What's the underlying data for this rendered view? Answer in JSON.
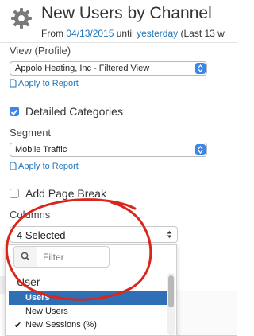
{
  "header": {
    "title": "New Users by Channel",
    "from_label": "From",
    "from_date": "04/13/2015",
    "until_label": "until",
    "until_date": "yesterday",
    "range_note": "(Last 13 w"
  },
  "view": {
    "label": "View (Profile)",
    "selected": "Appolo Heating, Inc - Filtered View",
    "apply_link": "Apply to Report"
  },
  "detailed": {
    "label": "Detailed Categories",
    "checked": true
  },
  "segment": {
    "label": "Segment",
    "selected": "Mobile Traffic",
    "apply_link": "Apply to Report"
  },
  "page_break": {
    "label": "Add Page Break",
    "checked": false
  },
  "columns": {
    "label": "Columns",
    "selected": "4 Selected",
    "filter_placeholder": "Filter",
    "group": "User",
    "options": [
      {
        "label": "Users",
        "highlighted": true,
        "checked": false
      },
      {
        "label": "New Users",
        "highlighted": false,
        "checked": false
      },
      {
        "label": "New Sessions (%)",
        "highlighted": false,
        "checked": true
      }
    ]
  },
  "colors": {
    "accent": "#3b86e8",
    "link": "#1f73b7",
    "highlight": "#2f6fb6",
    "annotation": "#d9261c"
  }
}
